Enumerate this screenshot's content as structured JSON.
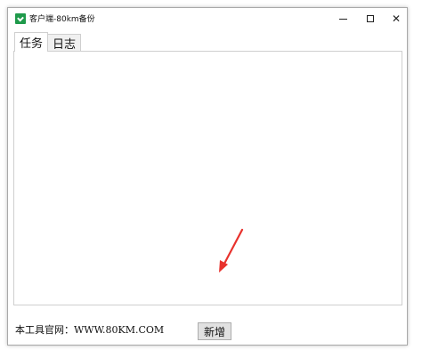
{
  "window": {
    "title": "客户端-80km备份"
  },
  "titlebar": {
    "minimize_glyph": "",
    "maximize_glyph": "",
    "close_glyph": "✕"
  },
  "tabs": [
    {
      "label": "任务",
      "active": true
    },
    {
      "label": "日志",
      "active": false
    }
  ],
  "main": {
    "add_button_label": "新增"
  },
  "footer": {
    "text": "本工具官网：WWW.80KM.COM"
  },
  "colors": {
    "accent_icon": "#1f9a4b",
    "annotation_arrow": "#e8322d"
  }
}
